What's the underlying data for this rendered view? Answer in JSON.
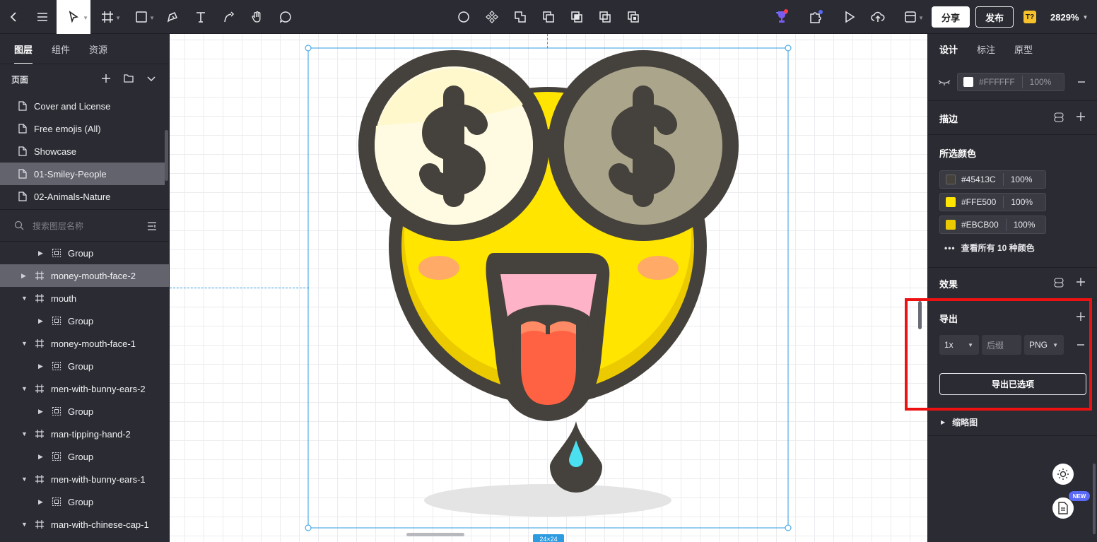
{
  "toolbar": {
    "share_label": "分享",
    "publish_label": "发布",
    "badge_label": "T?",
    "zoom": "2829%"
  },
  "left_panel": {
    "tabs": [
      "图层",
      "组件",
      "资源"
    ],
    "pages_title": "页面",
    "pages": [
      "Cover and License",
      "Free emojis (All)",
      "Showcase",
      "01-Smiley-People",
      "02-Animals-Nature"
    ],
    "selected_page": "01-Smiley-People",
    "search_placeholder": "搜索图层名称",
    "layers": [
      {
        "name": "Group",
        "kind": "group",
        "expanded": false
      },
      {
        "name": "money-mouth-face-2",
        "kind": "frame",
        "expanded": false,
        "selected": true
      },
      {
        "name": "mouth",
        "kind": "frame",
        "expanded": true
      },
      {
        "name": "Group",
        "kind": "group",
        "expanded": false
      },
      {
        "name": "money-mouth-face-1",
        "kind": "frame",
        "expanded": true
      },
      {
        "name": "Group",
        "kind": "group",
        "expanded": false
      },
      {
        "name": "men-with-bunny-ears-2",
        "kind": "frame",
        "expanded": true
      },
      {
        "name": "Group",
        "kind": "group",
        "expanded": false
      },
      {
        "name": "man-tipping-hand-2",
        "kind": "frame",
        "expanded": true
      },
      {
        "name": "Group",
        "kind": "group",
        "expanded": false
      },
      {
        "name": "men-with-bunny-ears-1",
        "kind": "frame",
        "expanded": true
      },
      {
        "name": "Group",
        "kind": "group",
        "expanded": false
      },
      {
        "name": "man-with-chinese-cap-1",
        "kind": "frame",
        "expanded": true
      }
    ]
  },
  "canvas": {
    "size_label": "24×24"
  },
  "right_panel": {
    "tabs": [
      "设计",
      "标注",
      "原型"
    ],
    "fill": {
      "hex": "#FFFFFF",
      "opacity": "100%"
    },
    "stroke_title": "描边",
    "selected_colors_title": "所选颜色",
    "colors": [
      {
        "hex": "#45413C",
        "opacity": "100%",
        "swatch": "#45413C"
      },
      {
        "hex": "#FFE500",
        "opacity": "100%",
        "swatch": "#FFE500"
      },
      {
        "hex": "#EBCB00",
        "opacity": "100%",
        "swatch": "#EBCB00"
      }
    ],
    "view_all_colors": "查看所有 10 种颜色",
    "effects_title": "效果",
    "export_title": "导出",
    "export_scale": "1x",
    "export_suffix_placeholder": "后缀",
    "export_format": "PNG",
    "export_button": "导出已选项",
    "thumbnail_title": "缩略图",
    "new_badge": "NEW"
  }
}
